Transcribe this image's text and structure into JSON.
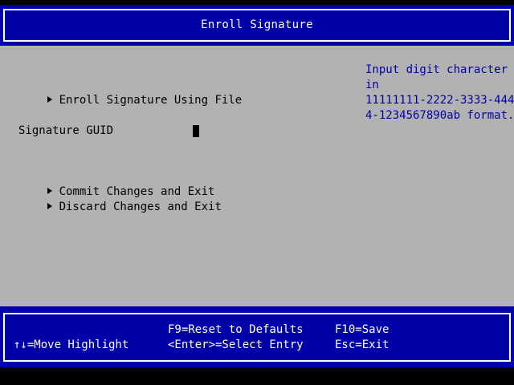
{
  "header": {
    "title": "Enroll Signature"
  },
  "menu": {
    "items": [
      {
        "label": "Enroll Signature Using File"
      },
      {
        "label": "Commit Changes and Exit"
      },
      {
        "label": "Discard Changes and Exit"
      }
    ]
  },
  "form": {
    "signature_guid_label": "Signature GUID",
    "signature_guid_value": ""
  },
  "help": {
    "lines": [
      "Input digit character",
      "in",
      "11111111-2222-3333-444",
      "4-1234567890ab format."
    ]
  },
  "footer": {
    "move_highlight": "↑↓=Move Highlight",
    "reset_defaults": "F9=Reset to Defaults",
    "select_entry": "<Enter>=Select Entry",
    "save": "F10=Save",
    "exit": "Esc=Exit"
  },
  "colors": {
    "bar_blue": "#0000a8",
    "body_gray": "#b2b2b2",
    "help_text_blue": "#0000a8",
    "text_white": "#ffffff"
  }
}
